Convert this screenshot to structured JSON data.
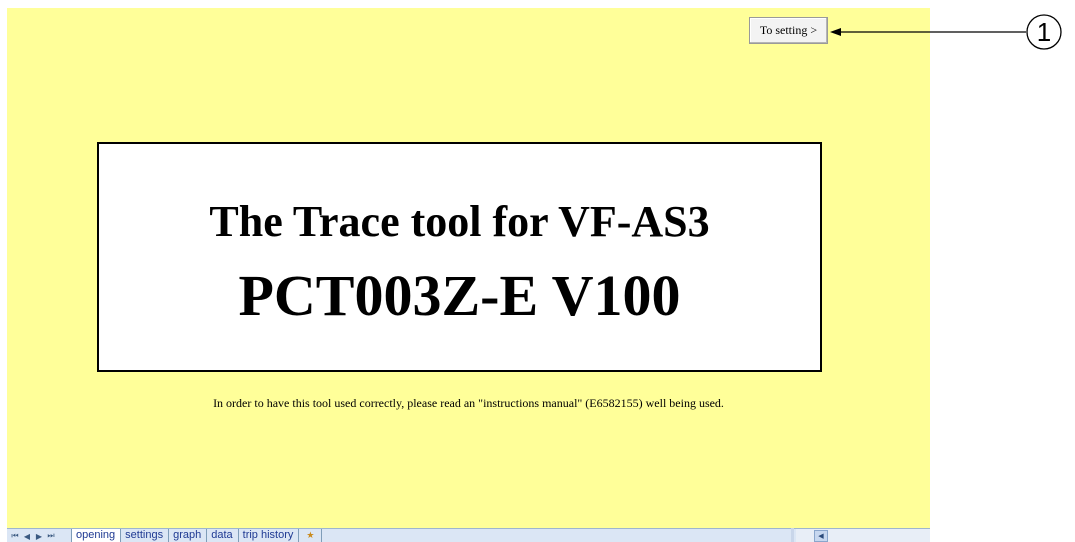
{
  "sheet": {
    "button_label": "To setting >",
    "callout_number": "1",
    "title_line1": "The Trace tool for VF-AS3",
    "title_line2": "PCT003Z-E  V100",
    "notice": "In order to have this tool used correctly, please read an \"instructions manual\" (E6582155) well being used."
  },
  "tabbar": {
    "nav": [
      "first-sheet-icon",
      "prev-sheet-icon",
      "next-sheet-icon",
      "last-sheet-icon"
    ],
    "tabs": [
      {
        "label": "opening",
        "active": true
      },
      {
        "label": "settings",
        "active": false
      },
      {
        "label": "graph",
        "active": false
      },
      {
        "label": "data",
        "active": false
      },
      {
        "label": "trip history",
        "active": false
      }
    ],
    "insert_icon": "insert-sheet-icon"
  },
  "colors": {
    "sheet_background": "#ffff99",
    "tab_bar": "#dbe6f5"
  }
}
